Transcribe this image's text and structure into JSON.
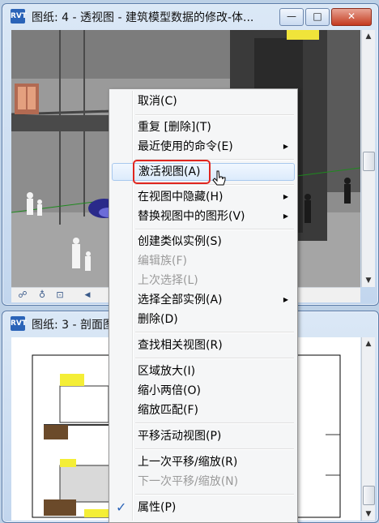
{
  "window_top": {
    "title": "图纸: 4 - 透视图 - 建筑模型数据的修改-体...",
    "icon": "revit-app-icon",
    "buttons": {
      "minimize": "—",
      "maximize": "□",
      "close": "✕"
    }
  },
  "window_bottom": {
    "title": "图纸: 3 - 剖面图",
    "icon": "revit-app-icon"
  },
  "context_menu": {
    "items": [
      {
        "label": "取消(C)",
        "enabled": true
      },
      {
        "label": "重复 [删除](T)",
        "enabled": true
      },
      {
        "label": "最近使用的命令(E)",
        "enabled": true,
        "submenu": true
      },
      {
        "label": "激活视图(A)",
        "enabled": true,
        "highlighted": true
      },
      {
        "label": "在视图中隐藏(H)",
        "enabled": true,
        "submenu": true
      },
      {
        "label": "替换视图中的图形(V)",
        "enabled": true,
        "submenu": true
      },
      {
        "label": "创建类似实例(S)",
        "enabled": true
      },
      {
        "label": "编辑族(F)",
        "enabled": false
      },
      {
        "label": "上次选择(L)",
        "enabled": false
      },
      {
        "label": "选择全部实例(A)",
        "enabled": true,
        "submenu": true
      },
      {
        "label": "删除(D)",
        "enabled": true
      },
      {
        "label": "查找相关视图(R)",
        "enabled": true
      },
      {
        "label": "区域放大(I)",
        "enabled": true
      },
      {
        "label": "缩小两倍(O)",
        "enabled": true
      },
      {
        "label": "缩放匹配(F)",
        "enabled": true
      },
      {
        "label": "平移活动视图(P)",
        "enabled": true
      },
      {
        "label": "上一次平移/缩放(R)",
        "enabled": true
      },
      {
        "label": "下一次平移/缩放(N)",
        "enabled": false
      },
      {
        "label": "属性(P)",
        "enabled": true,
        "checked": true
      }
    ],
    "submenu_arrow": "▶",
    "check_glyph": "✓"
  },
  "colors": {
    "highlight_border": "#e0261f",
    "accent": "#2b64b8"
  }
}
